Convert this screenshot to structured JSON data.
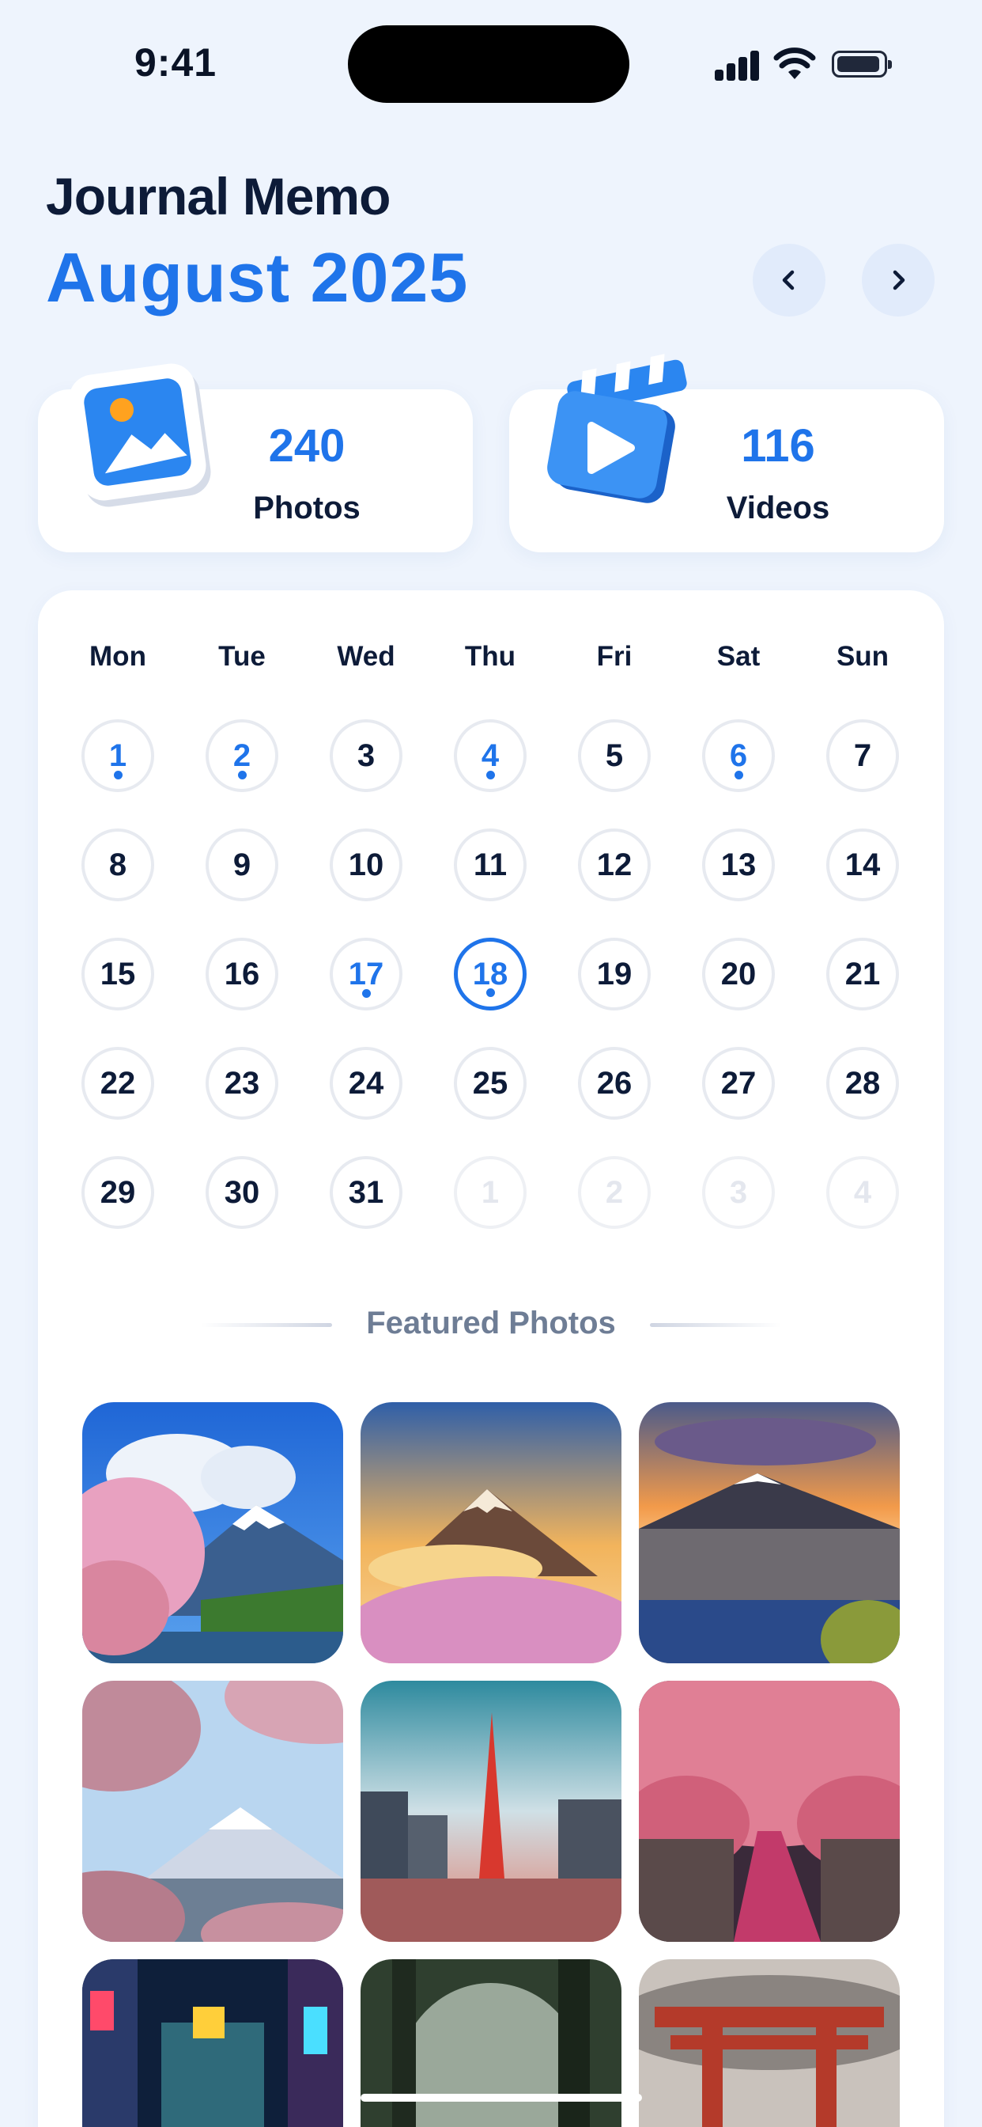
{
  "status": {
    "time": "9:41"
  },
  "header": {
    "app_title": "Journal Memo",
    "month": "August 2025",
    "prev_icon": "chevron-left-icon",
    "next_icon": "chevron-right-icon"
  },
  "stats": [
    {
      "count": "240",
      "label": "Photos",
      "icon": "photo-icon"
    },
    {
      "count": "116",
      "label": "Videos",
      "icon": "video-clapper-icon"
    }
  ],
  "calendar": {
    "weekdays": [
      "Mon",
      "Tue",
      "Wed",
      "Thu",
      "Fri",
      "Sat",
      "Sun"
    ],
    "weeks": [
      [
        "1",
        "2",
        "3",
        "4",
        "5",
        "6",
        "7"
      ],
      [
        "8",
        "9",
        "10",
        "11",
        "12",
        "13",
        "14"
      ],
      [
        "15",
        "16",
        "17",
        "18",
        "19",
        "20",
        "21"
      ],
      [
        "22",
        "23",
        "24",
        "25",
        "26",
        "27",
        "28"
      ],
      [
        "29",
        "30",
        "31",
        "1",
        "2",
        "3",
        "4"
      ]
    ],
    "marked_days": [
      "1",
      "2",
      "4",
      "6",
      "17",
      "18"
    ],
    "selected_day": "18"
  },
  "featured": {
    "title": "Featured Photos"
  },
  "colors": {
    "accent": "#1f74ea",
    "background": "#eef4fd",
    "card": "#ffffff",
    "text": "#0d1b38"
  }
}
